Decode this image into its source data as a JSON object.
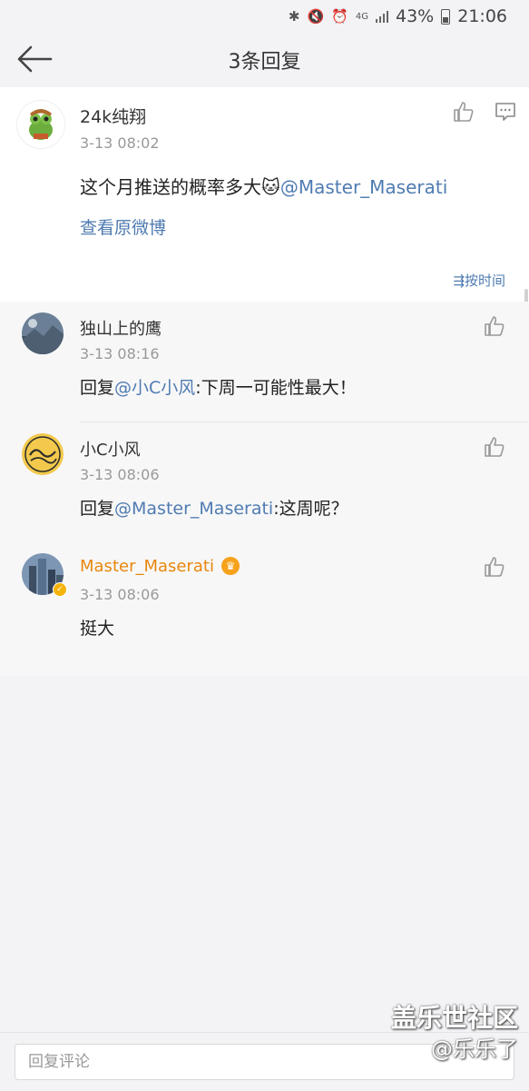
{
  "status_bar": {
    "network": "4G",
    "battery": "43%",
    "time": "21:06",
    "icons": [
      "bluetooth-icon",
      "mute-icon",
      "alarm-icon",
      "signal-icon",
      "battery-icon"
    ]
  },
  "header": {
    "title": "3条回复",
    "back_icon": "back-arrow-icon"
  },
  "post": {
    "username": "24k纯翔",
    "time": "3-13 08:02",
    "text": "这个月推送的概率多大",
    "emoji": "🐱",
    "mention": "@Master_Maserati",
    "view_original": "查看原微博",
    "like_icon": "thumbs-up-icon",
    "comment_icon": "comment-icon"
  },
  "sort": {
    "label": "按时间",
    "icon": "sort-icon"
  },
  "replies": [
    {
      "username": "独山上的鹰",
      "time": "3-13 08:16",
      "prefix": "回复",
      "mention": "@小C小风",
      "text": ":下周一可能性最大！"
    },
    {
      "username": "小C小风",
      "time": "3-13 08:06",
      "prefix": "回复",
      "mention": "@Master_Maserati",
      "text": ":这周呢？"
    },
    {
      "username": "Master_Maserati",
      "time": "3-13 08:06",
      "prefix": "",
      "mention": "",
      "text": "挺大",
      "username_color": "#e8870d",
      "verified": true
    }
  ],
  "input": {
    "placeholder": "回复评论"
  },
  "watermark": {
    "line1": "盖乐世社区",
    "line2": "@乐乐了"
  },
  "colors": {
    "link": "#4f7bb1",
    "vip_name": "#e8870d",
    "background": "#f3f2f5"
  }
}
